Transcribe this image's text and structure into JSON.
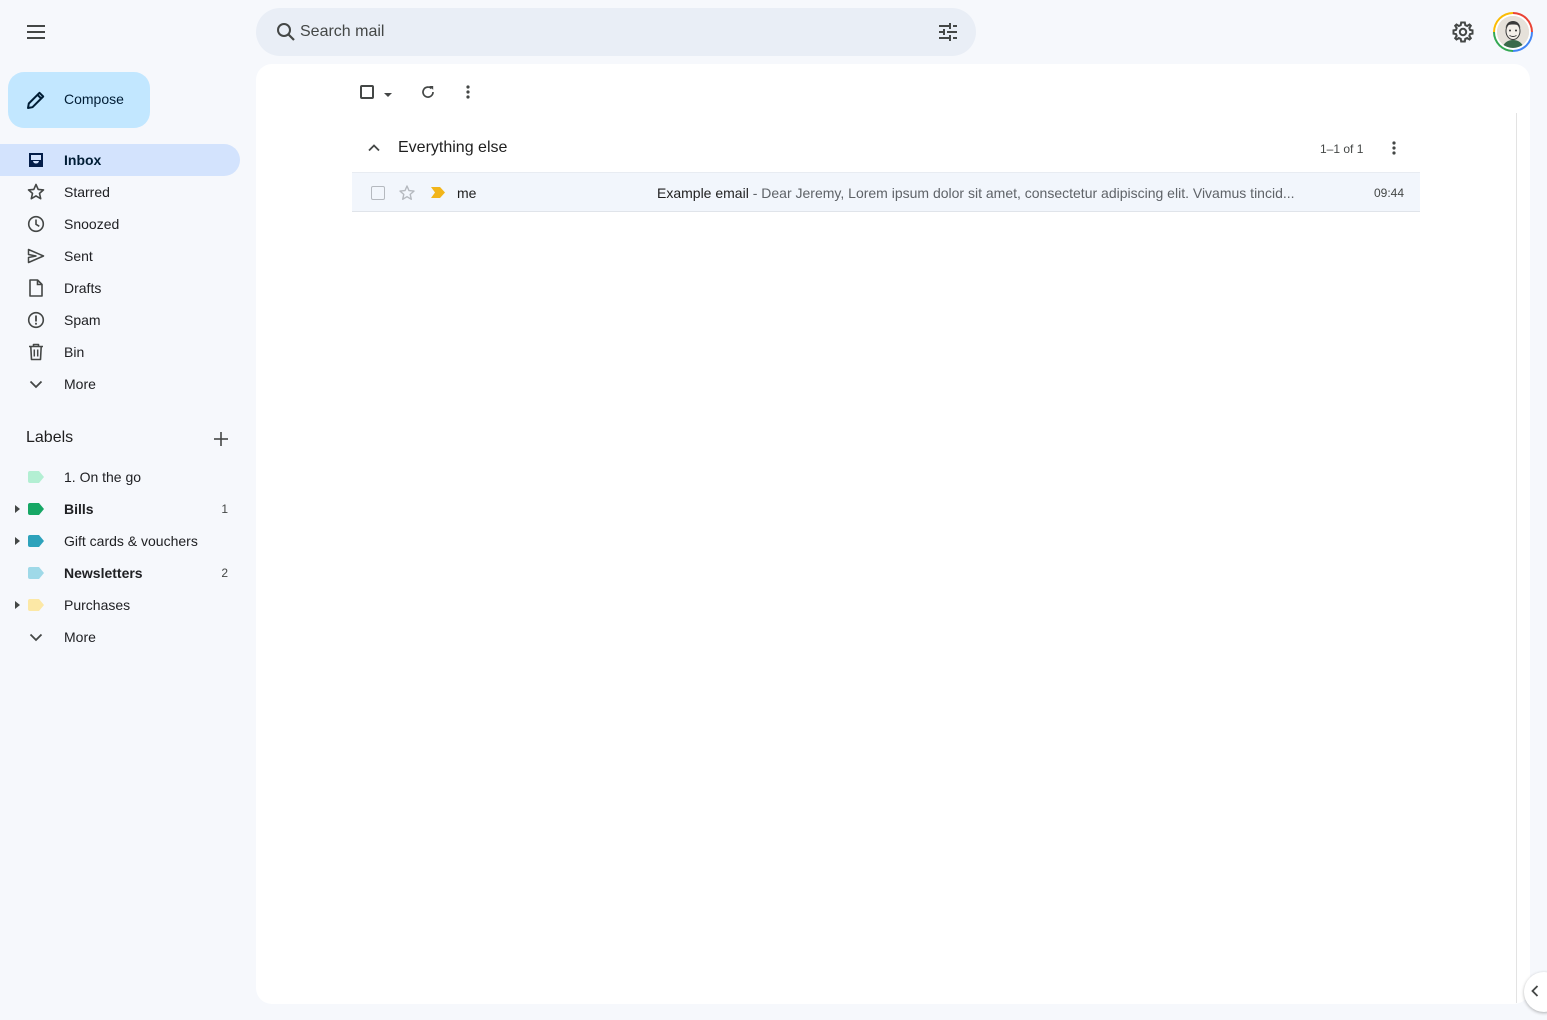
{
  "header": {
    "menu_icon": "hamburger-menu-icon",
    "search_placeholder": "Search mail",
    "search_icon": "search-icon",
    "filter_icon": "tune-icon",
    "settings_icon": "gear-icon",
    "avatar_icon": "account-avatar"
  },
  "sidebar": {
    "compose_label": "Compose",
    "items": [
      {
        "label": "Inbox",
        "icon": "inbox-icon",
        "active": true
      },
      {
        "label": "Starred",
        "icon": "star-icon"
      },
      {
        "label": "Snoozed",
        "icon": "clock-icon"
      },
      {
        "label": "Sent",
        "icon": "send-icon"
      },
      {
        "label": "Drafts",
        "icon": "draft-icon"
      },
      {
        "label": "Spam",
        "icon": "spam-icon"
      },
      {
        "label": "Bin",
        "icon": "trash-icon"
      },
      {
        "label": "More",
        "icon": "chevron-down-icon"
      }
    ],
    "labels_title": "Labels",
    "labels": [
      {
        "label": "1. On the go",
        "color": "#b3efd3",
        "expandable": false,
        "bold": false,
        "count": ""
      },
      {
        "label": "Bills",
        "color": "#16a765",
        "expandable": true,
        "bold": true,
        "count": "1"
      },
      {
        "label": "Gift cards & vouchers",
        "color": "#2da2bb",
        "expandable": true,
        "bold": false,
        "count": ""
      },
      {
        "label": "Newsletters",
        "color": "#9fd9e8",
        "expandable": false,
        "bold": true,
        "count": "2"
      },
      {
        "label": "Purchases",
        "color": "#fce8a6",
        "expandable": true,
        "bold": false,
        "count": ""
      }
    ],
    "labels_more": "More"
  },
  "main": {
    "section_title": "Everything else",
    "pagination": "1–1 of 1",
    "emails": [
      {
        "sender": "me",
        "subject": "Example email",
        "separator": " - ",
        "preview": "Dear Jeremy, Lorem ipsum dolor sit amet, consectetur adipiscing elit. Vivamus tincid...",
        "time": "09:44",
        "important_color": "#f2b51a"
      }
    ]
  },
  "colors": {
    "page_bg": "#f6f8fc",
    "active_nav": "#d3e3fd",
    "compose_bg": "#c2e7ff",
    "search_bg": "#e9eef6"
  }
}
